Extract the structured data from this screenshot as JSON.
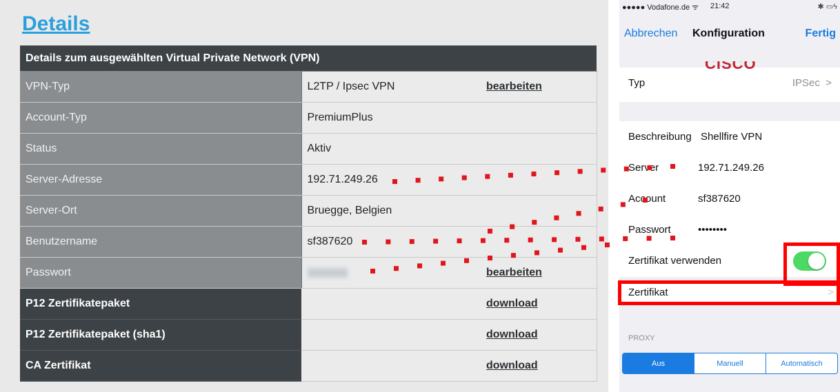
{
  "web": {
    "title": "Details",
    "table_header": "Details zum ausgewählten Virtual Private Network (VPN)",
    "rows": [
      {
        "label": "VPN-Typ",
        "value": "L2TP / Ipsec VPN",
        "action": "bearbeiten"
      },
      {
        "label": "Account-Typ",
        "value": "PremiumPlus",
        "action": ""
      },
      {
        "label": "Status",
        "value": "Aktiv",
        "action": ""
      },
      {
        "label": "Server-Adresse",
        "value": "192.71.249.26",
        "action": ""
      },
      {
        "label": "Server-Ort",
        "value": "Bruegge, Belgien",
        "action": ""
      },
      {
        "label": "Benutzername",
        "value": "sf387620",
        "action": ""
      },
      {
        "label": "Passwort",
        "value": "",
        "action": "bearbeiten"
      }
    ],
    "downloads": [
      {
        "label": "P12 Zertifikatepaket",
        "action": "download"
      },
      {
        "label": "P12 Zertifikatepaket (sha1)",
        "action": "download"
      },
      {
        "label": "CA Zertifikat",
        "action": "download"
      }
    ]
  },
  "ios": {
    "status": {
      "carrier": "●●●●● Vodafone.de ᯤ",
      "time": "21:42",
      "battery": "✱ ▭ϟ"
    },
    "nav": {
      "cancel": "Abbrechen",
      "title": "Konfiguration",
      "done": "Fertig"
    },
    "logo_text": "CISCO",
    "typ": {
      "label": "Typ",
      "value": "IPSec",
      "chevron": ">"
    },
    "beschreibung": {
      "label": "Beschreibung",
      "value": "Shellfire VPN"
    },
    "server": {
      "label": "Server",
      "value": "192.71.249.26"
    },
    "account": {
      "label": "Account",
      "value": "sf387620"
    },
    "passwort": {
      "label": "Passwort",
      "value": "••••••••"
    },
    "zertifikat_verwenden": {
      "label": "Zertifikat verwenden",
      "on": true
    },
    "zertifikat": {
      "label": "Zertifikat",
      "chevron": ">"
    },
    "proxy": {
      "header": "PROXY",
      "options": [
        "Aus",
        "Manuell",
        "Automatisch"
      ],
      "selected": "Aus"
    }
  },
  "colors": {
    "accent_blue": "#1a7be0",
    "link_blue": "#2b9fdc",
    "highlight_red": "#ff0000",
    "dot_red": "#e0161c",
    "toggle_green": "#4cd964"
  }
}
